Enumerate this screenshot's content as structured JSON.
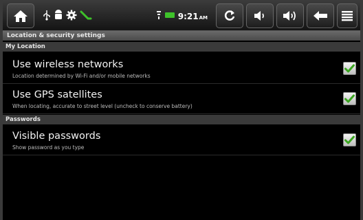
{
  "status_bar": {
    "home_icon": "home-icon",
    "notification_icons": [
      "usb-icon",
      "android-debug-icon",
      "settings-icon",
      "download-icon"
    ],
    "wifi_icon": "wifi-icon",
    "battery_icon": "battery-icon",
    "battery_color": "#3ec22a",
    "time": "9:21",
    "time_suffix": "AM",
    "buttons": [
      "refresh-icon",
      "volume-down-icon",
      "volume-up-icon",
      "back-icon",
      "menu-icon"
    ]
  },
  "title": "Location & security settings",
  "sections": [
    {
      "header": "My Location",
      "items": [
        {
          "title": "Use wireless networks",
          "summary": "Location determined by Wi-Fi and/or mobile networks",
          "checked": true
        },
        {
          "title": "Use GPS satellites",
          "summary": "When locating, accurate to street level (uncheck to conserve battery)",
          "checked": true
        }
      ]
    },
    {
      "header": "Passwords",
      "items": [
        {
          "title": "Visible passwords",
          "summary": "Show password as you type",
          "checked": true
        }
      ]
    }
  ],
  "colors": {
    "check_green": "#3aa61f",
    "background": "#000000",
    "title_bar": "#5a5a5a",
    "section_header": "#3a3a3a"
  }
}
